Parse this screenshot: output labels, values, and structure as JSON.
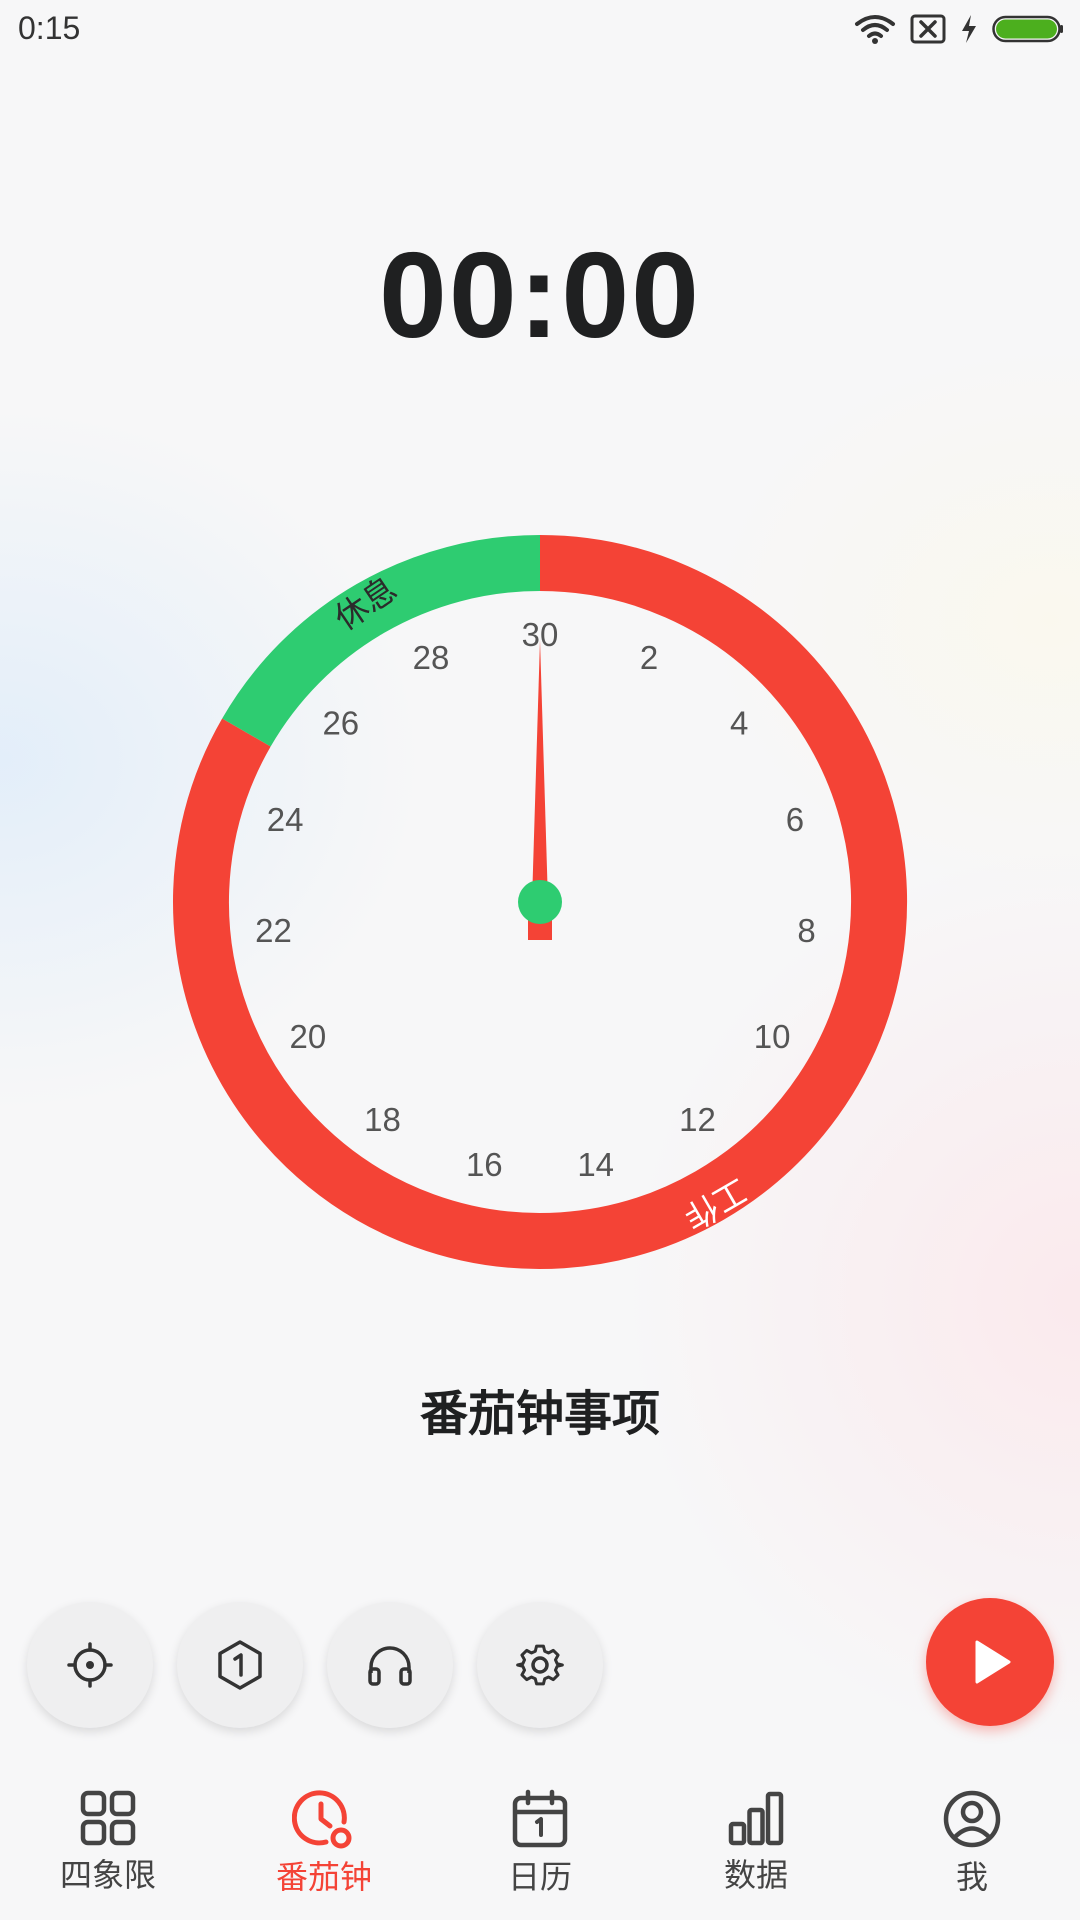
{
  "status_bar": {
    "time": "0:15"
  },
  "timer": {
    "display": "00:00"
  },
  "dial": {
    "ticks": [
      "30",
      "2",
      "4",
      "6",
      "8",
      "10",
      "12",
      "14",
      "16",
      "18",
      "20",
      "22",
      "24",
      "26",
      "28"
    ],
    "work_label": "工作",
    "rest_label": "休息",
    "colors": {
      "work": "#f44336",
      "rest": "#2ecc71",
      "hand": "#f44336",
      "hub": "#2ecc71"
    }
  },
  "task": {
    "title": "番茄钟事项"
  },
  "controls": {
    "buttons": [
      {
        "icon": "target-icon"
      },
      {
        "icon": "hexagon-one-icon"
      },
      {
        "icon": "headphones-icon"
      },
      {
        "icon": "gear-icon"
      }
    ],
    "play_icon": "play-icon"
  },
  "nav": {
    "items": [
      {
        "label": "四象限",
        "icon": "grid-icon"
      },
      {
        "label": "番茄钟",
        "icon": "clock-icon",
        "active": true
      },
      {
        "label": "日历",
        "icon": "calendar-icon"
      },
      {
        "label": "数据",
        "icon": "bar-chart-icon"
      },
      {
        "label": "我",
        "icon": "profile-icon"
      }
    ]
  }
}
